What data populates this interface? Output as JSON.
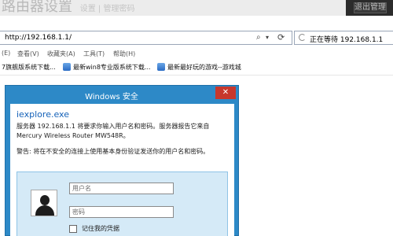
{
  "background_page": {
    "title": "路由器设置",
    "subtitle": "设置 | 管理密码",
    "corner_button": "退出管理"
  },
  "address_bar": {
    "url": "http://192.168.1.1/",
    "search_icon": "search-icon",
    "dropdown_icon": "chevron-down-icon",
    "refresh_icon": "refresh-icon"
  },
  "tab": {
    "label": "正在等待 192.168.1.1",
    "icon": "spinner-icon"
  },
  "menu": {
    "items": [
      "(E)",
      "查看(V)",
      "收藏夹(A)",
      "工具(T)",
      "帮助(H)"
    ]
  },
  "favorites": {
    "items": [
      "7旗舰版系统下载...",
      "最新win8专业版系统下载...",
      "最新最好玩的游戏--游戏城"
    ]
  },
  "dialog": {
    "title": "Windows 安全",
    "close_icon": "close-icon",
    "app_name": "iexplore.exe",
    "server_message": "服务器 192.168.1.1 将要求你输入用户名和密码。服务器报告它来自 Mercury Wireless Router MW548R。",
    "warning_message": "警告: 将在不安全的连接上使用基本身份验证发送你的用户名和密码。",
    "username_placeholder": "用户名",
    "password_placeholder": "密码",
    "remember_label": "记住我的凭据",
    "avatar_icon": "user-avatar-icon"
  },
  "colors": {
    "dialog_frame": "#2d89c7",
    "close_button": "#c7372c",
    "credential_tile": "#d5eaf7",
    "app_name": "#1461b8"
  }
}
